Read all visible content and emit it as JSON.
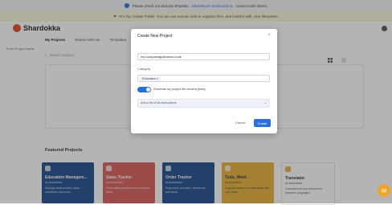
{
  "banner_notice": {
    "prefix": "Please check out and join ShareBo",
    "link": "ShareRoom at Discord to",
    "suffix": "connect with others."
  },
  "banner_warning": {
    "text": "Pro Tip: Create Folder. You can use normal code to organize files, and install it with, new filesystem."
  },
  "app": {
    "brand": "Shardokka",
    "tabs": [
      "My Projects",
      "Shared with me",
      "Templates"
    ]
  },
  "search": {
    "placeholder": "Search projects"
  },
  "featured": {
    "title": "Featured Projects",
    "cards": [
      {
        "title": "Education Managem...",
        "sub": "by shardokka",
        "desc": "Manage student data, class schedules and more.",
        "color": "#1f4e8c",
        "text_color": "#ffffff",
        "icon": "grid-icon"
      },
      {
        "title": "Sales Tracker",
        "sub": "by shardokka",
        "desc": "Track sales pipelines and customer deals.",
        "color": "#d9605a",
        "text_color": "#ffffff",
        "icon": "chart-icon"
      },
      {
        "title": "Order Tracker",
        "sub": "by shardokka",
        "desc": "Keep track of orders, shipments and stock.",
        "color": "#1f4e8c",
        "text_color": "#ffffff",
        "icon": "box-icon"
      },
      {
        "title": "Todo, Work",
        "sub": "by shardokka",
        "desc": "Organize tasks and collaborate with your team.",
        "color": "#e8b33a",
        "text_color": "#333333",
        "icon": "check-icon"
      },
      {
        "title": "Translator",
        "sub": "by shardokka",
        "desc": "Translate text and documents between languages.",
        "color": "#ffffff",
        "text_color": "#333333",
        "icon": "globe-icon"
      }
    ]
  },
  "modal": {
    "title": "Create New Project",
    "close": "×",
    "name_label": "Enter Project Name",
    "name_value": "my-compactapplication-code",
    "category_label": "Category",
    "category_chip": "Education ×",
    "toggle_label": "Generate my project file content (beta)",
    "summary_text": "Add a list of AI instructions",
    "cancel_label": "Cancel",
    "create_label": "Create"
  }
}
